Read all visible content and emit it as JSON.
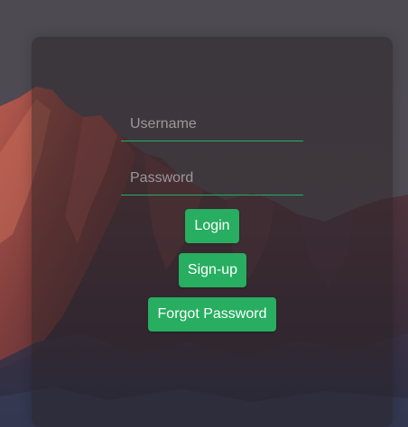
{
  "login_form": {
    "username_placeholder": "Username",
    "password_placeholder": "Password",
    "login_label": "Login",
    "signup_label": "Sign-up",
    "forgot_label": "Forgot Password"
  },
  "colors": {
    "accent": "#27ae60",
    "panel": "#2e2628",
    "background_sky": "#4a4750"
  }
}
